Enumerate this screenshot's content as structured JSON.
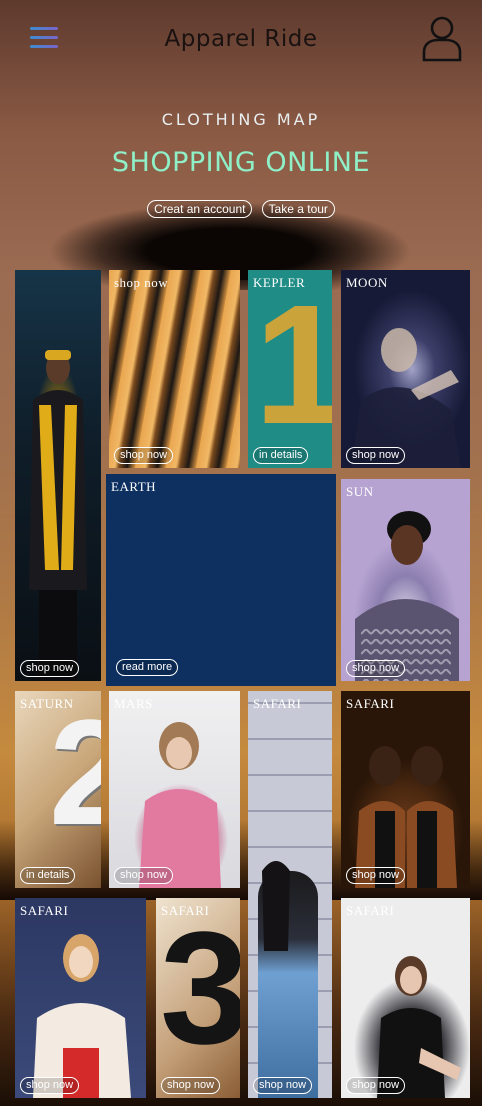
{
  "header": {
    "title": "Apparel Ride",
    "menu_icon": "hamburger-menu-icon",
    "user_icon": "user-profile-icon"
  },
  "hero": {
    "kicker": "CLOTHING MAP",
    "headline": "SHOPPING ONLINE",
    "create_account": "Creat an account",
    "take_tour": "Take a tour"
  },
  "tiles": {
    "person1": {
      "title": "",
      "button": "shop now"
    },
    "hangers": {
      "title": "shop now",
      "button": "shop now"
    },
    "kepler": {
      "title": "KEPLER",
      "button": "in details",
      "numeral": "1"
    },
    "moon": {
      "title": "MOON",
      "button": "shop now"
    },
    "earth": {
      "title": "EARTH",
      "button": "read more"
    },
    "sun": {
      "title": "SUN",
      "button": "shop now"
    },
    "saturn": {
      "title": "SATURN",
      "button": "in details",
      "numeral": "2"
    },
    "mars": {
      "title": "MARS",
      "button": "shop now"
    },
    "safari1": {
      "title": "SAFARI",
      "button": "shop now"
    },
    "safari2": {
      "title": "SAFARI",
      "button": "shop now"
    },
    "safari3": {
      "title": "SAFARI",
      "button": "shop now"
    },
    "safari4": {
      "title": "SAFARI",
      "button": "shop now",
      "numeral": "3"
    },
    "safari5": {
      "title": "SAFARI",
      "button": "shop now"
    }
  },
  "colors": {
    "headline": "#8ff0c8",
    "kepler_bg": "#1f8c86",
    "earth_bg": "#0d3060",
    "menu_gradient_start": "#3c8dd0",
    "menu_gradient_end": "#7b63c8"
  }
}
